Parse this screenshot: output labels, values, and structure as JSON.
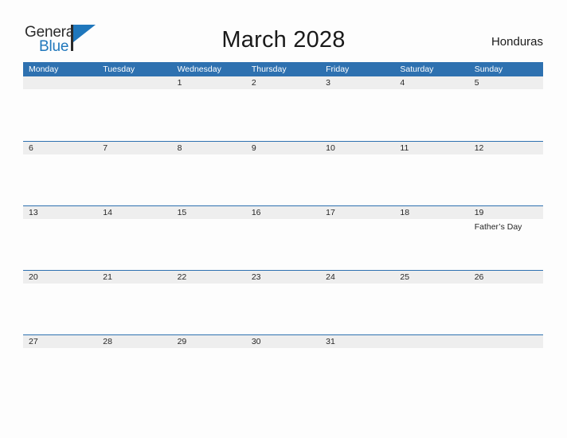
{
  "brand": {
    "name_part1": "General",
    "name_part2": "Blue",
    "accent_color": "#1f77bc"
  },
  "header": {
    "title": "March 2028",
    "country": "Honduras"
  },
  "calendar": {
    "month": "March",
    "year": "2028",
    "header_bg": "#2e71b0",
    "band_bg": "#eeeeee",
    "weekdays": [
      "Monday",
      "Tuesday",
      "Wednesday",
      "Thursday",
      "Friday",
      "Saturday",
      "Sunday"
    ],
    "weeks": [
      [
        {
          "day": "",
          "events": []
        },
        {
          "day": "",
          "events": []
        },
        {
          "day": "1",
          "events": []
        },
        {
          "day": "2",
          "events": []
        },
        {
          "day": "3",
          "events": []
        },
        {
          "day": "4",
          "events": []
        },
        {
          "day": "5",
          "events": []
        }
      ],
      [
        {
          "day": "6",
          "events": []
        },
        {
          "day": "7",
          "events": []
        },
        {
          "day": "8",
          "events": []
        },
        {
          "day": "9",
          "events": []
        },
        {
          "day": "10",
          "events": []
        },
        {
          "day": "11",
          "events": []
        },
        {
          "day": "12",
          "events": []
        }
      ],
      [
        {
          "day": "13",
          "events": []
        },
        {
          "day": "14",
          "events": []
        },
        {
          "day": "15",
          "events": []
        },
        {
          "day": "16",
          "events": []
        },
        {
          "day": "17",
          "events": []
        },
        {
          "day": "18",
          "events": []
        },
        {
          "day": "19",
          "events": [
            "Father’s Day"
          ]
        }
      ],
      [
        {
          "day": "20",
          "events": []
        },
        {
          "day": "21",
          "events": []
        },
        {
          "day": "22",
          "events": []
        },
        {
          "day": "23",
          "events": []
        },
        {
          "day": "24",
          "events": []
        },
        {
          "day": "25",
          "events": []
        },
        {
          "day": "26",
          "events": []
        }
      ],
      [
        {
          "day": "27",
          "events": []
        },
        {
          "day": "28",
          "events": []
        },
        {
          "day": "29",
          "events": []
        },
        {
          "day": "30",
          "events": []
        },
        {
          "day": "31",
          "events": []
        },
        {
          "day": "",
          "events": []
        },
        {
          "day": "",
          "events": []
        }
      ]
    ]
  }
}
